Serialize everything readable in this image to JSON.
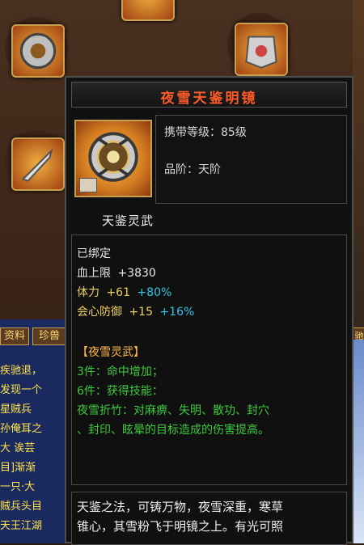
{
  "item": {
    "name": "夜雪天鉴明镜",
    "level_label": "携带等级：85级",
    "grade_label": "品阶：天阶",
    "set_name": "天鉴灵武"
  },
  "attributes": {
    "bound": "已绑定",
    "hp": {
      "label": "血上限",
      "value": "+3830"
    },
    "stamina": {
      "label": "体力",
      "value": "+61",
      "pct": "+80%"
    },
    "crit_def": {
      "label": "会心防御",
      "value": "+15",
      "pct": "+16%"
    }
  },
  "set_bonus": {
    "title": "【夜雪灵武】",
    "line1": "3件：命中增加；",
    "line2": "6件：获得技能：",
    "line3": "夜雪折竹：对麻痹、失明、散功、封穴",
    "line4": "、封印、眩晕的目标造成的伤害提高。"
  },
  "description": {
    "line1": "天鉴之法，可铸万物，夜雪深重，寒草",
    "line2": "锥心，其雪粉飞于明镜之上。有光可照"
  },
  "background": {
    "tab1": "资料",
    "tab2": "珍兽",
    "tab3": "驰",
    "chat_lines": [
      "疾驰退，",
      "发现一个",
      "星贼兵",
      "孙俺耳之",
      "大 诶芸",
      "目]渐渐",
      "一只·大",
      "贼兵头目",
      "天王江湖"
    ]
  },
  "colors": {
    "title": "#ff5a28",
    "cyan": "#32c6e8",
    "yellow": "#f0d060",
    "orange": "#ffb84a",
    "green": "#3ec83e"
  }
}
